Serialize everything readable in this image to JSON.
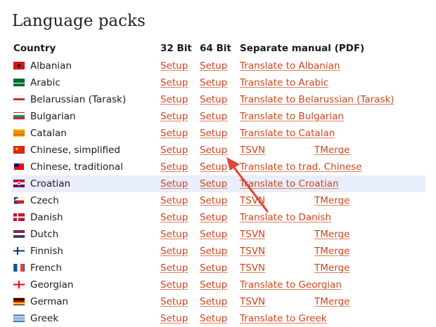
{
  "title": "Language packs",
  "columns": {
    "country": "Country",
    "bit32": "32 Bit",
    "bit64": "64 Bit",
    "manual": "Separate manual (PDF)"
  },
  "rows": [
    {
      "country": "Albanian",
      "setup32": "Setup",
      "setup64": "Setup",
      "manual": "Translate to Albanian",
      "tmerge": ""
    },
    {
      "country": "Arabic",
      "setup32": "Setup",
      "setup64": "Setup",
      "manual": "Translate to Arabic",
      "tmerge": ""
    },
    {
      "country": "Belarussian (Tarask)",
      "setup32": "Setup",
      "setup64": "Setup",
      "manual": "Translate to Belarussian (Tarask)",
      "tmerge": ""
    },
    {
      "country": "Bulgarian",
      "setup32": "Setup",
      "setup64": "Setup",
      "manual": "Translate to Bulgarian",
      "tmerge": ""
    },
    {
      "country": "Catalan",
      "setup32": "Setup",
      "setup64": "Setup",
      "manual": "Translate to Catalan",
      "tmerge": ""
    },
    {
      "country": "Chinese, simplified",
      "setup32": "Setup",
      "setup64": "Setup",
      "manual": "TSVN",
      "tmerge": "TMerge"
    },
    {
      "country": "Chinese, traditional",
      "setup32": "Setup",
      "setup64": "Setup",
      "manual": "Translate to trad. Chinese",
      "tmerge": ""
    },
    {
      "country": "Croatian",
      "setup32": "Setup",
      "setup64": "Setup",
      "manual": "Translate to Croatian",
      "tmerge": ""
    },
    {
      "country": "Czech",
      "setup32": "Setup",
      "setup64": "Setup",
      "manual": "TSVN",
      "tmerge": "TMerge"
    },
    {
      "country": "Danish",
      "setup32": "Setup",
      "setup64": "Setup",
      "manual": "Translate to Danish",
      "tmerge": ""
    },
    {
      "country": "Dutch",
      "setup32": "Setup",
      "setup64": "Setup",
      "manual": "TSVN",
      "tmerge": "TMerge"
    },
    {
      "country": "Finnish",
      "setup32": "Setup",
      "setup64": "Setup",
      "manual": "TSVN",
      "tmerge": "TMerge"
    },
    {
      "country": "French",
      "setup32": "Setup",
      "setup64": "Setup",
      "manual": "TSVN",
      "tmerge": "TMerge"
    },
    {
      "country": "Georgian",
      "setup32": "Setup",
      "setup64": "Setup",
      "manual": "Translate to Georgian",
      "tmerge": ""
    },
    {
      "country": "German",
      "setup32": "Setup",
      "setup64": "Setup",
      "manual": "TSVN",
      "tmerge": "TMerge"
    },
    {
      "country": "Greek",
      "setup32": "Setup",
      "setup64": "Setup",
      "manual": "Translate to Greek",
      "tmerge": ""
    }
  ],
  "flag_icons": [
    "albania-flag-icon",
    "saudi-arabia-flag-icon",
    "belarus-flag-icon",
    "bulgaria-flag-icon",
    "catalonia-flag-icon",
    "china-flag-icon",
    "taiwan-flag-icon",
    "croatia-flag-icon",
    "czech-flag-icon",
    "denmark-flag-icon",
    "netherlands-flag-icon",
    "finland-flag-icon",
    "france-flag-icon",
    "georgia-flag-icon",
    "germany-flag-icon",
    "greece-flag-icon"
  ],
  "highlighted_row": "Croatian",
  "colors": {
    "link": "#d0441c",
    "highlight_row": "#e8eefb",
    "annotation_arrow": "#e0443a",
    "text": "#1a1a1a"
  }
}
